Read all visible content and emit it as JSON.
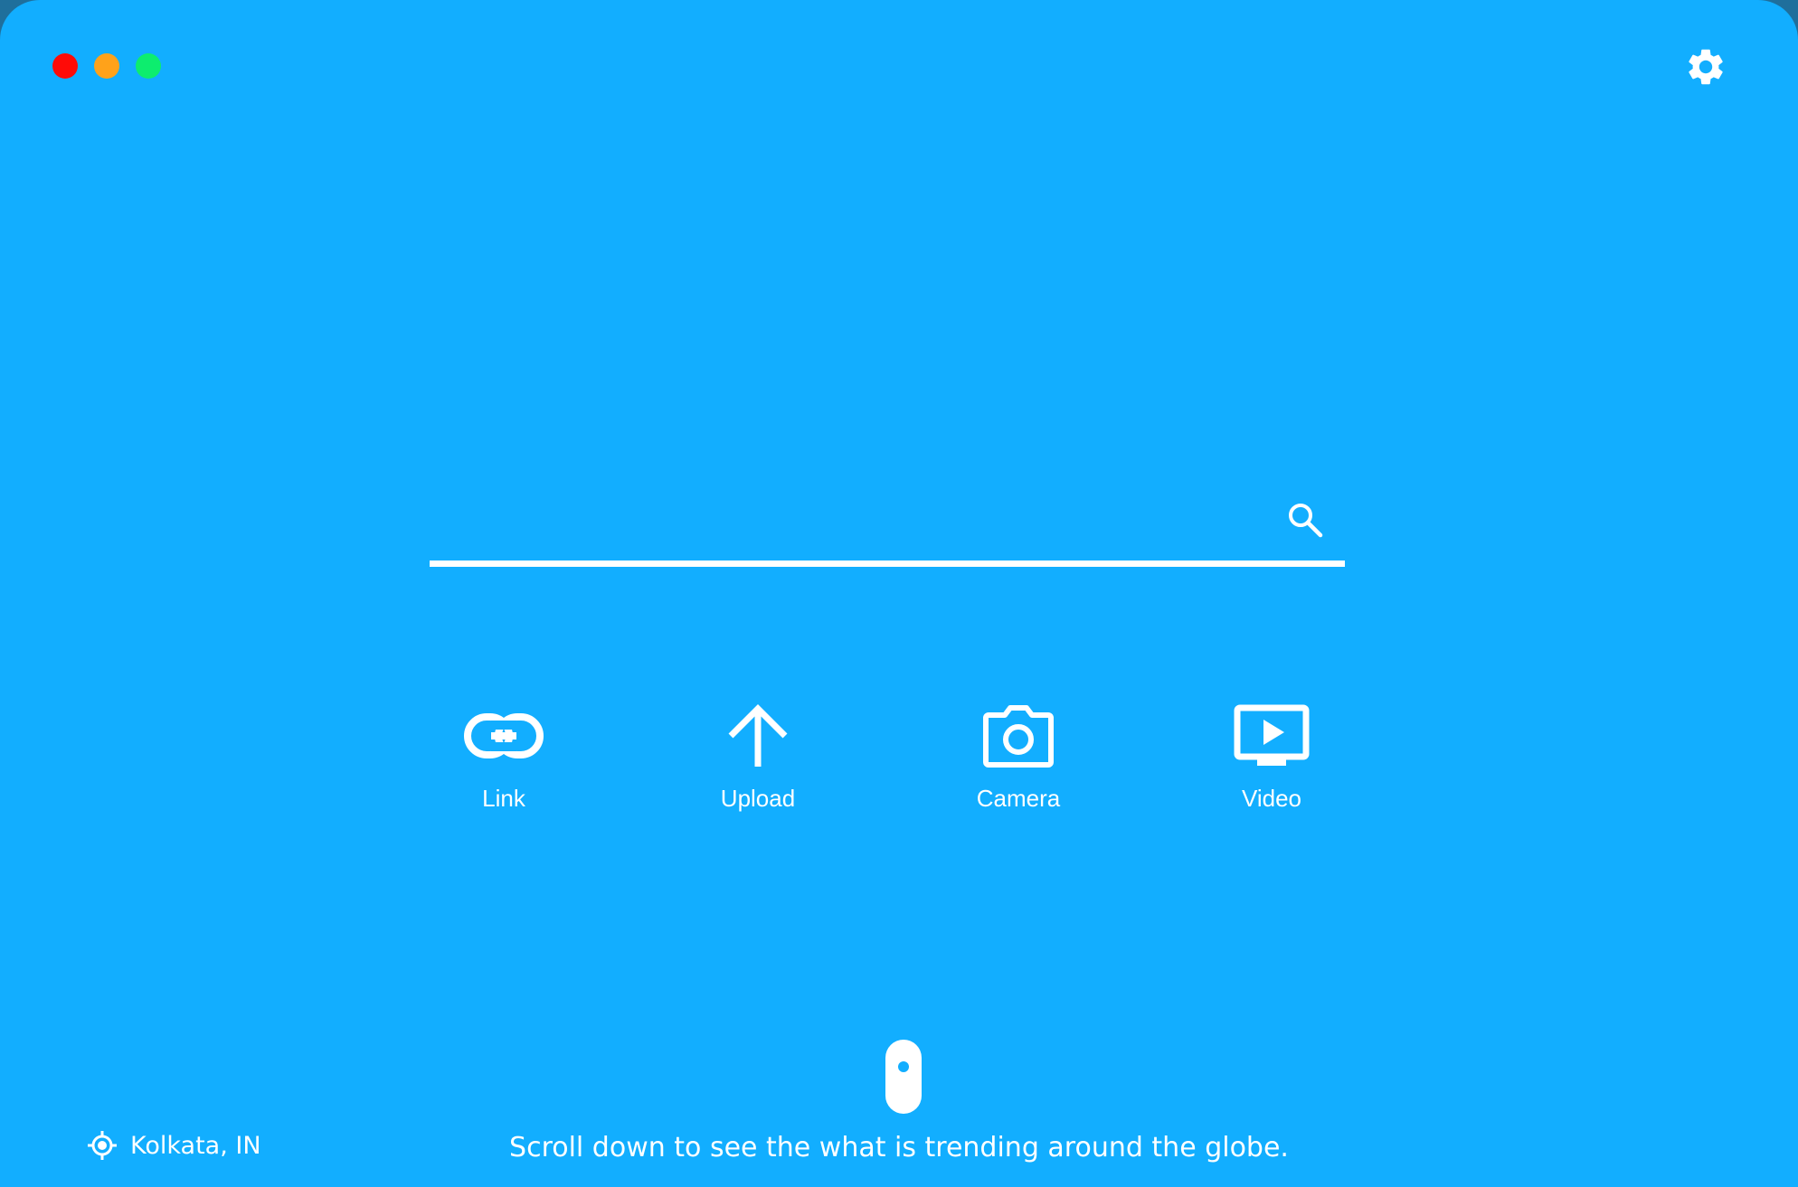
{
  "window": {
    "controls": [
      "close",
      "minimize",
      "maximize"
    ],
    "colors": {
      "background": "#12aeff",
      "close": "#ff0b07",
      "minimize": "#ffa21a",
      "maximize": "#0ded6e",
      "foreground": "#ffffff"
    }
  },
  "header": {
    "settings_icon": "gear-icon"
  },
  "search": {
    "value": "",
    "placeholder": "",
    "icon": "search-icon"
  },
  "actions": [
    {
      "label": "Link",
      "icon": "link-icon"
    },
    {
      "label": "Upload",
      "icon": "upload-arrow-icon"
    },
    {
      "label": "Camera",
      "icon": "camera-icon"
    },
    {
      "label": "Video",
      "icon": "video-icon"
    }
  ],
  "footer": {
    "location": "Kolkata, IN",
    "location_icon": "location-target-icon",
    "scroll_hint": "Scroll down to see the what is trending around the globe.",
    "scroll_icon": "mouse-scroll-icon"
  }
}
